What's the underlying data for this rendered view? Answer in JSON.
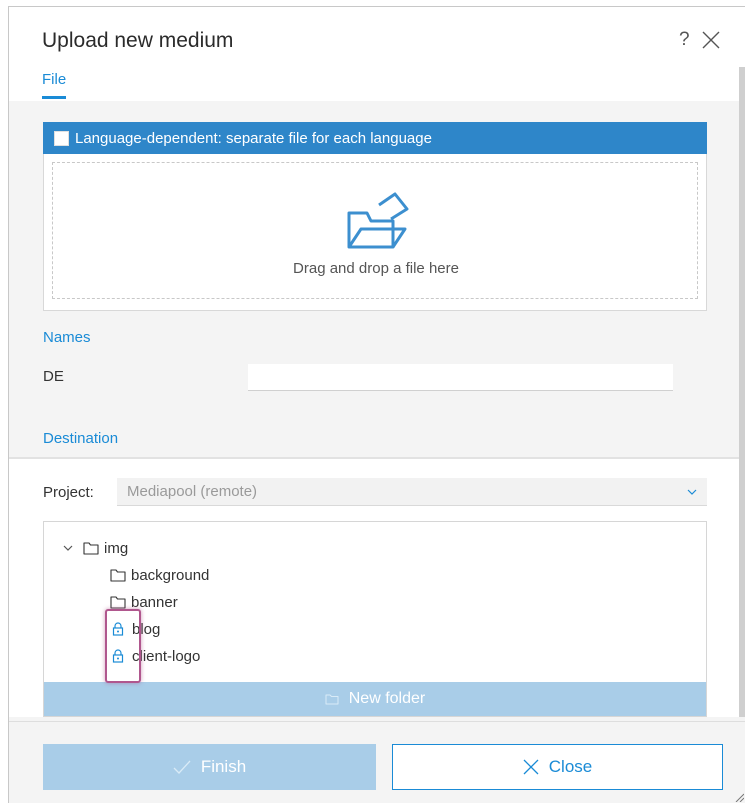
{
  "dialog": {
    "title": "Upload new medium",
    "help_symbol": "?",
    "tab_label": "File"
  },
  "upload": {
    "language_dependent_label": "Language-dependent: separate file for each language",
    "drop_text": "Drag and drop a file here"
  },
  "names": {
    "section_label": "Names",
    "language_code": "DE",
    "value": ""
  },
  "destination": {
    "section_label": "Destination",
    "project_label": "Project:",
    "project_value": "Mediapool (remote)",
    "tree": [
      {
        "label": "img",
        "expanded": true,
        "icon": "folder-icon"
      },
      {
        "label": "background",
        "icon": "folder-icon"
      },
      {
        "label": "banner",
        "icon": "folder-icon"
      },
      {
        "label": "blog",
        "icon": "lock-icon"
      },
      {
        "label": "client-logo",
        "icon": "lock-icon"
      }
    ],
    "new_folder_label": "New folder"
  },
  "footer": {
    "finish_label": "Finish",
    "close_label": "Close"
  },
  "colors": {
    "accent": "#1a8bd6",
    "bar_blue": "#2e86c9",
    "disabled_blue": "#a9cde8",
    "highlight": "#b0578e"
  }
}
